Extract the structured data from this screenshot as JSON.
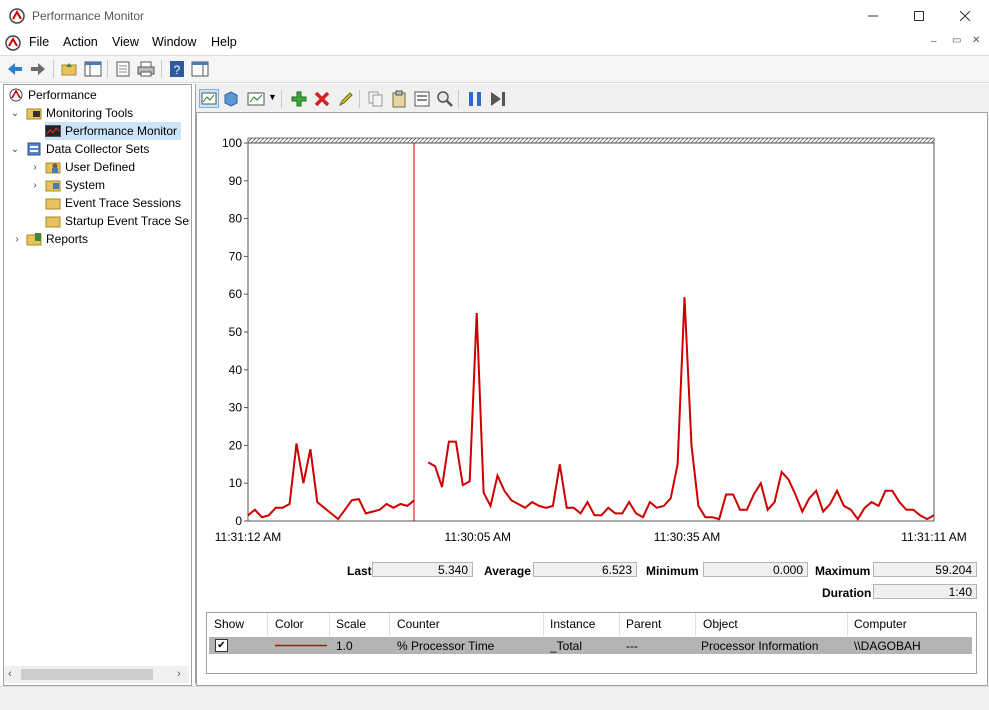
{
  "window": {
    "title": "Performance Monitor",
    "minimize_icon": "minimize-icon",
    "maximize_icon": "maximize-icon",
    "close_icon": "close-icon"
  },
  "menu": {
    "items": [
      "File",
      "Action",
      "View",
      "Window",
      "Help"
    ],
    "mdi_controls": [
      "–",
      "▭",
      "✕"
    ]
  },
  "tree": {
    "items": [
      {
        "label": "Performance",
        "icon": "performance-icon"
      },
      {
        "label": "Monitoring Tools",
        "icon": "folder-tools-icon"
      },
      {
        "label": "Performance Monitor",
        "icon": "perfmon-graph-icon"
      },
      {
        "label": "Data Collector Sets",
        "icon": "data-collector-icon"
      },
      {
        "label": "User Defined",
        "icon": "folder-user-icon"
      },
      {
        "label": "System",
        "icon": "folder-system-icon"
      },
      {
        "label": "Event Trace Sessions",
        "icon": "folder-icon"
      },
      {
        "label": "Startup Event Trace Sessions",
        "icon": "folder-icon"
      },
      {
        "label": "Reports",
        "icon": "reports-icon"
      }
    ]
  },
  "graph": {
    "x_labels": [
      "11:31:12 AM",
      "11:30:05 AM",
      "11:30:35 AM",
      "11:31:11 AM"
    ],
    "y_ticks": [
      "100",
      "90",
      "80",
      "70",
      "60",
      "50",
      "40",
      "30",
      "20",
      "10",
      "0"
    ],
    "line_color": "#cc0000"
  },
  "stats": {
    "last_label": "Last",
    "last_value": "5.340",
    "average_label": "Average",
    "average_value": "6.523",
    "minimum_label": "Minimum",
    "minimum_value": "0.000",
    "maximum_label": "Maximum",
    "maximum_value": "59.204",
    "duration_label": "Duration",
    "duration_value": "1:40"
  },
  "table": {
    "headers": [
      "Show",
      "Color",
      "Scale",
      "Counter",
      "Instance",
      "Parent",
      "Object",
      "Computer"
    ],
    "row": {
      "show_checked": "✔",
      "scale": "1.0",
      "counter": "% Processor Time",
      "instance": "_Total",
      "parent": "---",
      "object": "Processor Information",
      "computer": "\\\\DAGOBAH"
    }
  },
  "chart_data": {
    "type": "line",
    "ylim": [
      0,
      100
    ],
    "x_start": "11:31:12 AM",
    "x_end": "11:31:11 AM",
    "series": [
      {
        "name": "% Processor Time",
        "values": [
          1.5,
          3,
          1,
          1.5,
          3.5,
          3.5,
          4.5,
          20.5,
          10,
          19,
          5,
          3.5,
          2,
          0.5,
          3,
          5.5,
          5.8,
          2,
          2.5,
          3,
          4.5,
          3.5,
          4.5,
          4,
          5.5,
          null,
          15.5,
          14.5,
          9,
          21,
          21,
          9.5,
          10.5,
          55,
          7.5,
          4,
          12,
          8,
          5.5,
          4.5,
          3.5,
          5,
          4,
          3.5,
          4,
          15,
          3.5,
          3.5,
          2,
          5,
          1.5,
          1.5,
          3.5,
          2,
          2,
          5,
          2,
          1,
          5,
          3.5,
          4,
          6,
          15,
          59.2,
          20,
          4,
          1,
          1,
          0.5,
          7,
          7,
          3,
          3,
          7,
          10,
          3,
          5,
          13,
          11,
          7,
          2.5,
          6,
          8,
          2.5,
          4.5,
          8,
          4,
          3,
          0.5,
          3.5,
          5,
          4,
          8,
          8,
          5,
          3,
          3,
          1.5,
          0.5,
          1.5
        ]
      }
    ]
  }
}
